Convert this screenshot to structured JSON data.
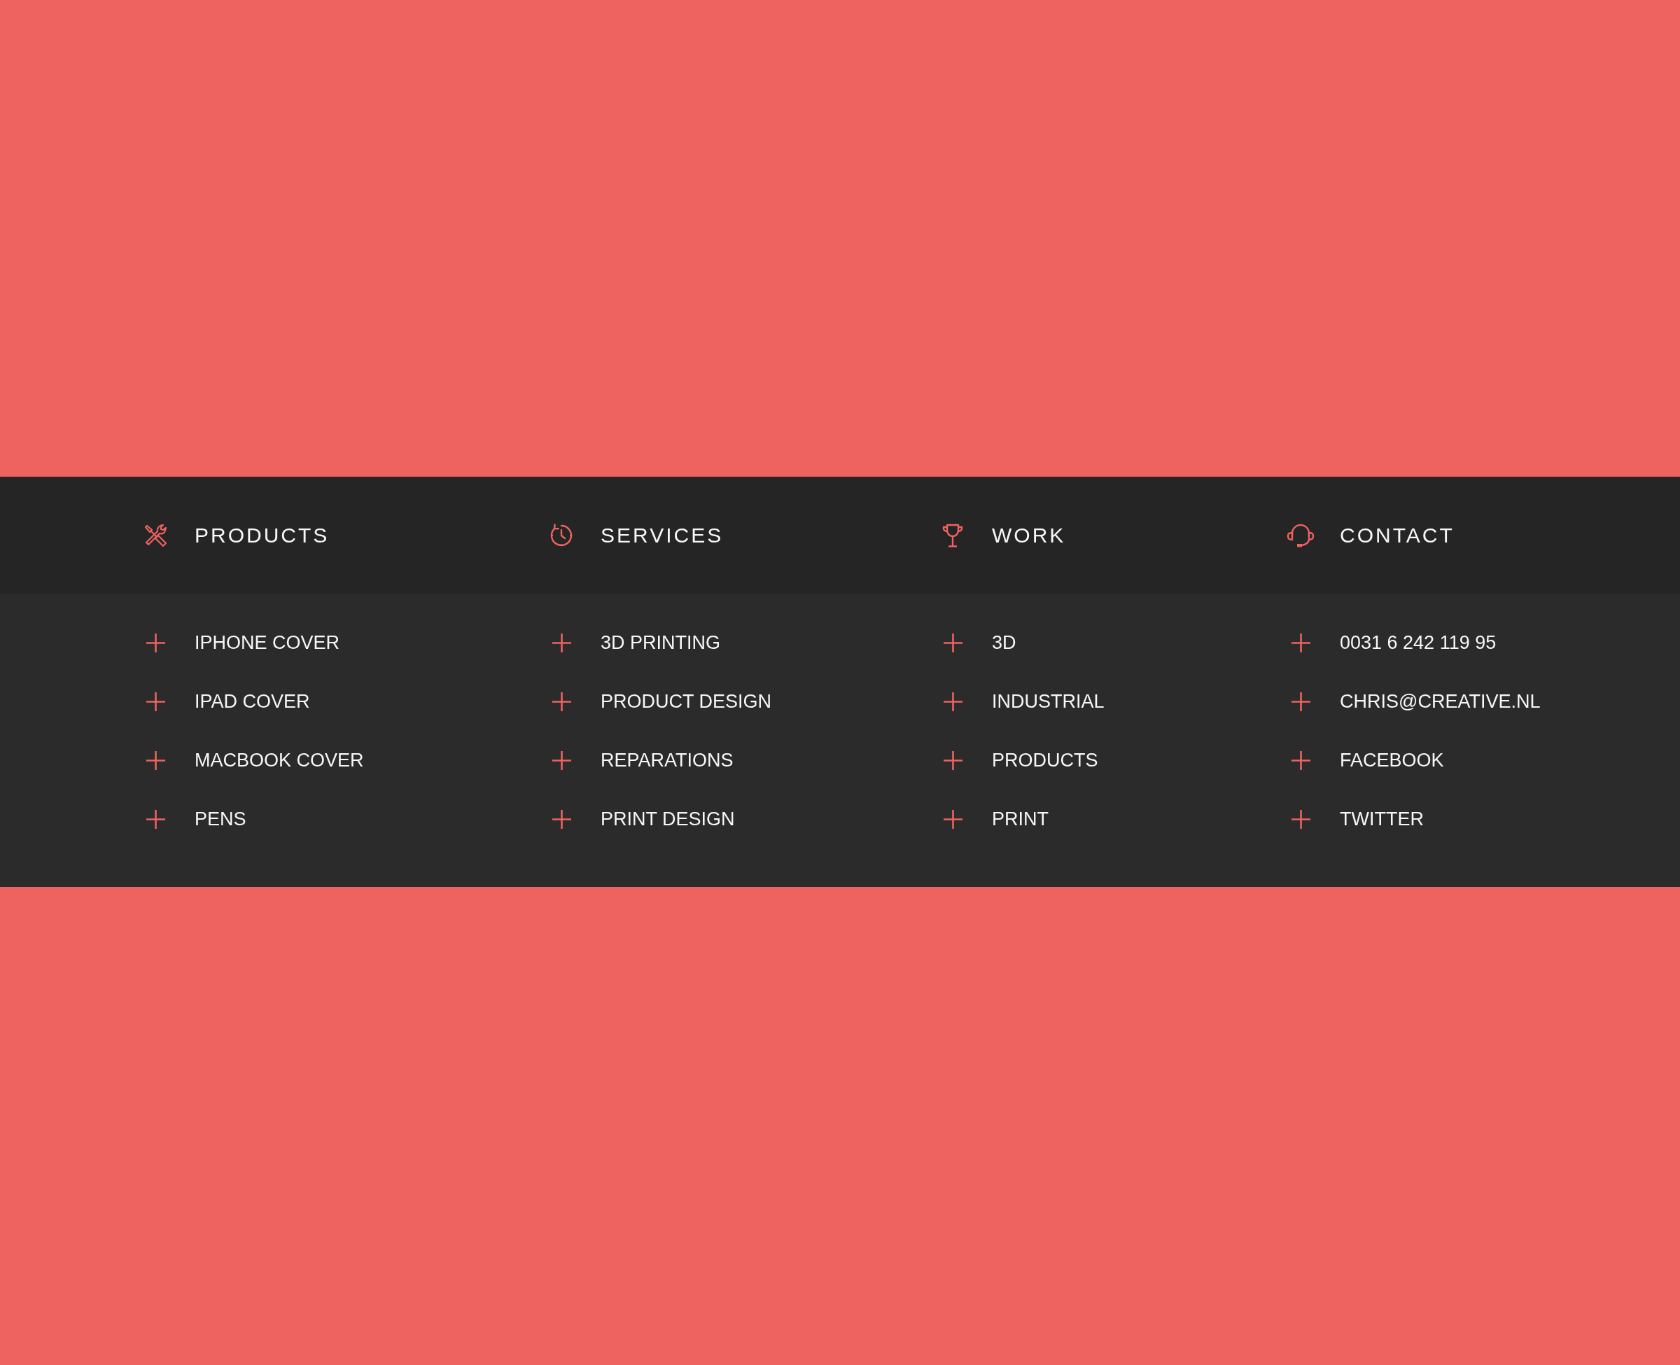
{
  "footer": {
    "columns": [
      {
        "heading": "PRODUCTS",
        "links": [
          "IPHONE COVER",
          "IPAD COVER",
          "MACBOOK COVER",
          "PENS"
        ]
      },
      {
        "heading": "SERVICES",
        "links": [
          "3D PRINTING",
          "PRODUCT DESIGN",
          "REPARATIONS",
          "PRINT DESIGN"
        ]
      },
      {
        "heading": "WORK",
        "links": [
          "3D",
          "INDUSTRIAL",
          "PRODUCTS",
          "PRINT"
        ]
      },
      {
        "heading": "CONTACT",
        "links": [
          "0031 6 242 119 95",
          "CHRIS@CREATIVE.NL",
          "FACEBOOK",
          "TWITTER"
        ]
      }
    ]
  }
}
